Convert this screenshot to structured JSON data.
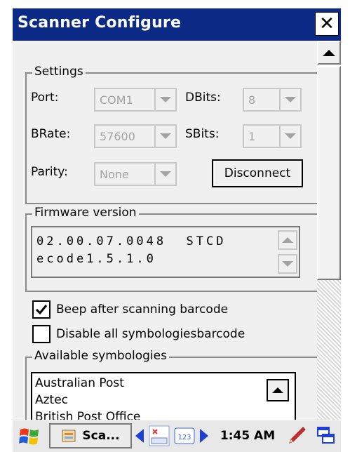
{
  "window": {
    "title": "Scanner Configure",
    "close_glyph": "✕"
  },
  "settings": {
    "legend": "Settings",
    "port_label": "Port:",
    "port_value": "COM1",
    "dbits_label": "DBits:",
    "dbits_value": "8",
    "brate_label": "BRate:",
    "brate_value": "57600",
    "sbits_label": "SBits:",
    "sbits_value": "1",
    "parity_label": "Parity:",
    "parity_value": "None",
    "disconnect_label": "Disconnect"
  },
  "firmware": {
    "legend": "Firmware version",
    "line1": "02.00.07.0048  STCD",
    "line2": "ecode1.5.1.0"
  },
  "options": {
    "beep_label": "Beep after scanning barcode",
    "beep_checked": true,
    "disable_label": "Disable all symbologiesbarcode",
    "disable_checked": false
  },
  "symbologies": {
    "legend": "Available symbologies",
    "items": [
      "Australian Post",
      "Aztec",
      "British Post Office"
    ]
  },
  "taskbar": {
    "app_label": "Sca...",
    "time": "1:45 AM",
    "icons": [
      "windows-flag-icon",
      "app-icon",
      "left-arrow-icon",
      "input-method-icon",
      "keyboard-123-icon",
      "right-arrow-icon",
      "pen-icon",
      "windows-cascade-icon"
    ]
  },
  "colors": {
    "titlebar": "#0a2a86",
    "client": "#f0f0f0",
    "disabled_text": "#a3a3a3"
  }
}
